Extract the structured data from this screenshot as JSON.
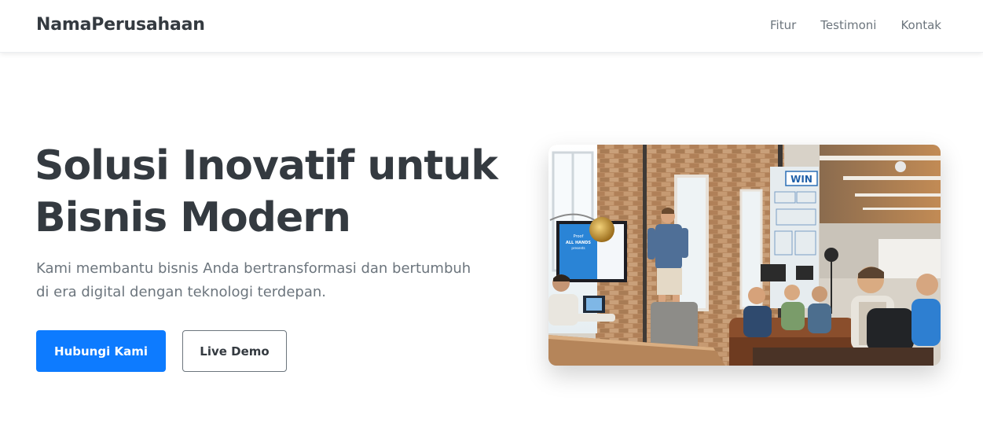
{
  "navbar": {
    "brand": "NamaPerusahaan",
    "links": [
      "Fitur",
      "Testimoni",
      "Kontak"
    ]
  },
  "hero": {
    "title_line1": "Solusi Inovatif untuk",
    "title_line2": "Bisnis Modern",
    "subtitle_line1": "Kami membantu bisnis Anda bertransformasi dan bertumbuh",
    "subtitle_line2": "di era digital dengan teknologi terdepan.",
    "primary_button": "Hubungi Kami",
    "secondary_button": "Live Demo",
    "image": {
      "screen_text": [
        "Proof",
        "ALL HANDS",
        "presents"
      ],
      "sign_text": "WIN"
    }
  },
  "colors": {
    "primary": "#0d7bff",
    "text_dark": "#343a40",
    "text_muted": "#6c757d"
  }
}
